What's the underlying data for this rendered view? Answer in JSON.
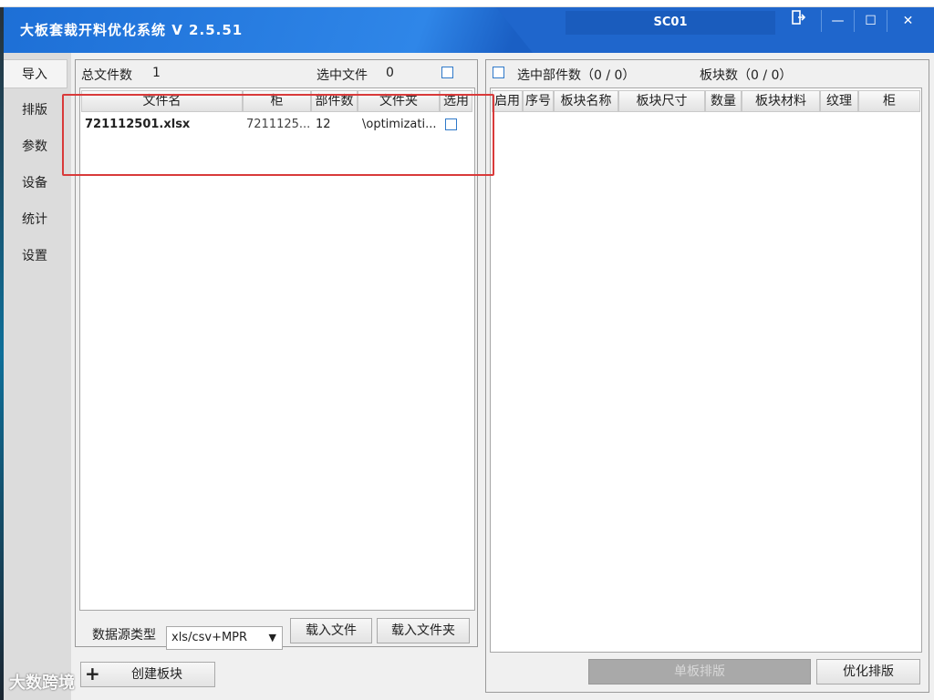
{
  "app": {
    "title": "大板套裁开料优化系统 V 2.5.51",
    "station": "SC01",
    "window_controls": {
      "exit_icon": "exit-icon",
      "minimize": "—",
      "maximize": "☐",
      "close": "✕"
    }
  },
  "sidebar": {
    "items": [
      {
        "label": "导入",
        "active": true
      },
      {
        "label": "排版"
      },
      {
        "label": "参数"
      },
      {
        "label": "设备"
      },
      {
        "label": "统计"
      },
      {
        "label": "设置"
      }
    ]
  },
  "file_panel": {
    "total_label": "总文件数",
    "total_value": "1",
    "selected_label": "选中文件",
    "selected_value": "0",
    "columns": [
      "文件名",
      "柜",
      "部件数",
      "文件夹",
      "选用"
    ],
    "rows": [
      {
        "filename": "721112501.xlsx",
        "cabinet": "7211125...",
        "parts": "12",
        "folder": "\\optimizati..."
      }
    ],
    "source_type_label": "数据源类型",
    "source_type_value": "xls/csv+MPR",
    "load_file_button": "载入文件",
    "load_folder_button": "载入文件夹"
  },
  "board_panel": {
    "selected_parts_label": "选中部件数（0 / 0）",
    "board_count_label": "板块数（0 / 0）",
    "columns": [
      "启用",
      "序号",
      "板块名称",
      "板块尺寸",
      "数量",
      "板块材料",
      "纹理",
      "柜"
    ],
    "single_layout_button": "单板排版",
    "optimize_button": "优化排版"
  },
  "create_board_button": "创建板块",
  "watermark": "大数跨境",
  "colors": {
    "titlebar": "#1d6fd6",
    "highlight": "#d93a3a",
    "checkbox": "#2f79c9"
  }
}
